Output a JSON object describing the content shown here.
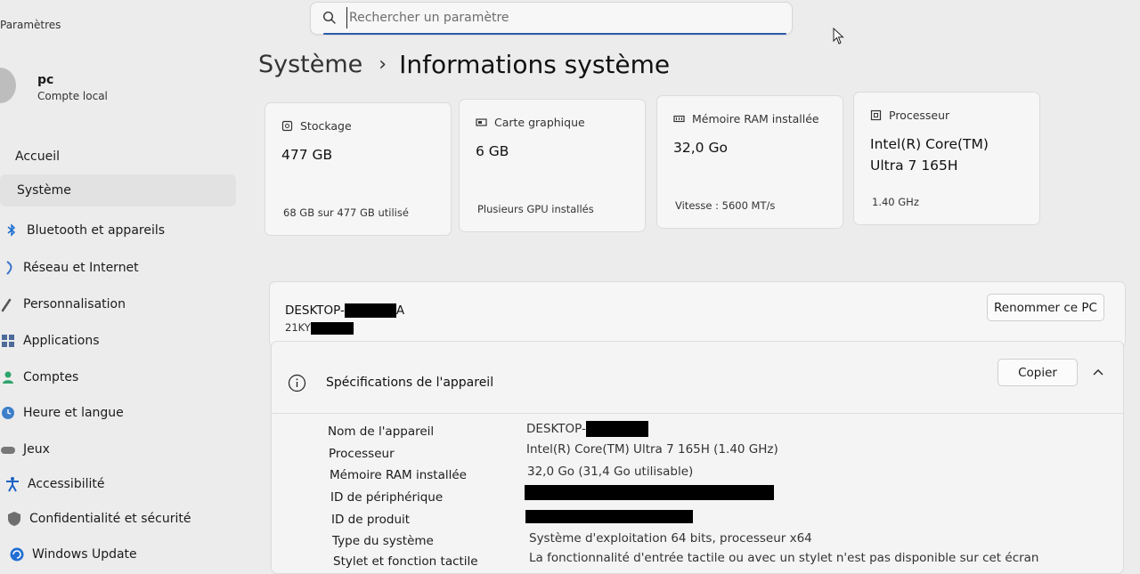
{
  "app": {
    "title": "Paramètres"
  },
  "search": {
    "placeholder": "Rechercher un paramètre"
  },
  "user": {
    "name": "pc",
    "account_type": "Compte local"
  },
  "sidebar": {
    "items": [
      {
        "label": "Accueil",
        "icon": "home-icon"
      },
      {
        "label": "Système",
        "icon": "system-icon",
        "active": true
      },
      {
        "label": "Bluetooth et appareils",
        "icon": "bluetooth-icon"
      },
      {
        "label": "Réseau et Internet",
        "icon": "network-icon"
      },
      {
        "label": "Personnalisation",
        "icon": "brush-icon"
      },
      {
        "label": "Applications",
        "icon": "apps-icon"
      },
      {
        "label": "Comptes",
        "icon": "person-icon"
      },
      {
        "label": "Heure et langue",
        "icon": "clock-globe-icon"
      },
      {
        "label": "Jeux",
        "icon": "gamepad-icon"
      },
      {
        "label": "Accessibilité",
        "icon": "accessibility-icon"
      },
      {
        "label": "Confidentialité et sécurité",
        "icon": "shield-icon"
      },
      {
        "label": "Windows Update",
        "icon": "update-icon"
      }
    ]
  },
  "breadcrumb": {
    "parent": "Système",
    "separator": "›",
    "current": "Informations système"
  },
  "cards": [
    {
      "label": "Stockage",
      "value": "477 GB",
      "footer": "68 GB sur 477 GB utilisé",
      "icon": "storage-icon"
    },
    {
      "label": "Carte graphique",
      "value": "6 GB",
      "footer": "Plusieurs GPU installés",
      "icon": "gpu-icon"
    },
    {
      "label": "Mémoire RAM installée",
      "value": "32,0 Go",
      "footer": "Vitesse : 5600 MT/s",
      "icon": "ram-icon"
    },
    {
      "label": "Processeur",
      "value": "Intel(R) Core(TM) Ultra 7 165H",
      "footer": "1.40 GHz",
      "icon": "cpu-icon"
    }
  ],
  "device": {
    "name_prefix": "DESKTOP-",
    "name_suffix": "A",
    "model_prefix": "21KY",
    "rename_label": "Renommer ce PC"
  },
  "specs": {
    "title": "Spécifications de l'appareil",
    "copy_label": "Copier",
    "rows": [
      {
        "label": "Nom de l'appareil",
        "value": "DESKTOP-"
      },
      {
        "label": "Processeur",
        "value": "Intel(R) Core(TM) Ultra 7 165H (1.40 GHz)"
      },
      {
        "label": "Mémoire RAM installée",
        "value": "32,0 Go (31,4 Go utilisable)"
      },
      {
        "label": "ID de périphérique",
        "value": ""
      },
      {
        "label": "ID de produit",
        "value": ""
      },
      {
        "label": "Type du système",
        "value": "Système d'exploitation 64 bits, processeur x64"
      },
      {
        "label": "Stylet et fonction tactile",
        "value": "La fonctionnalité d'entrée tactile ou avec un stylet n'est pas disponible sur cet écran"
      }
    ]
  }
}
